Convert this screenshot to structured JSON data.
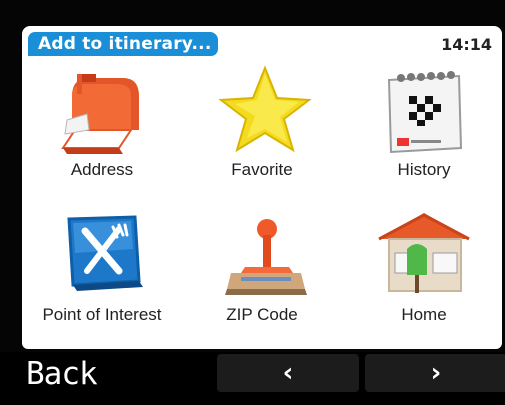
{
  "header": {
    "title": "Add to itinerary...",
    "time": "14:14"
  },
  "tiles": [
    {
      "label": "Address",
      "icon": "mailbox-icon"
    },
    {
      "label": "Favorite",
      "icon": "star-icon"
    },
    {
      "label": "History",
      "icon": "calendar-checkered-flag-icon"
    },
    {
      "label": "Point of Interest",
      "icon": "fork-knife-icon"
    },
    {
      "label": "ZIP Code",
      "icon": "stamp-icon"
    },
    {
      "label": "Home",
      "icon": "house-icon"
    }
  ],
  "footer": {
    "back_label": "Back",
    "prev_label": "‹",
    "next_label": "›"
  },
  "colors": {
    "accent": "#1a8fd7",
    "background": "#000000",
    "panel": "#ffffff"
  }
}
